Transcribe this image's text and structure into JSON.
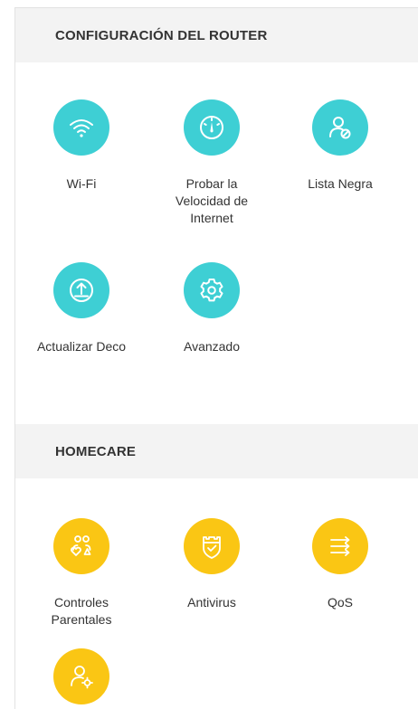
{
  "colors": {
    "router_accent": "#3ecfd4",
    "homecare_accent": "#fac614",
    "header_bg": "#f3f3f3",
    "text": "#333333"
  },
  "router_section": {
    "title": "CONFIGURACIÓN DEL ROUTER",
    "items": [
      {
        "label": "Wi-Fi",
        "icon": "wifi-icon"
      },
      {
        "label": "Probar la\nVelocidad de\nInternet",
        "icon": "speedometer-icon"
      },
      {
        "label": "Lista Negra",
        "icon": "blocked-user-icon"
      },
      {
        "label": "Actualizar Deco",
        "icon": "upload-icon"
      },
      {
        "label": "Avanzado",
        "icon": "gear-icon"
      }
    ]
  },
  "homecare_section": {
    "title": "HOMECARE",
    "items": [
      {
        "label": "Controles\nParentales",
        "icon": "parental-controls-icon"
      },
      {
        "label": "Antivirus",
        "icon": "shield-icon"
      },
      {
        "label": "QoS",
        "icon": "qos-arrows-icon"
      },
      {
        "label": "",
        "icon": "user-settings-icon"
      }
    ]
  }
}
